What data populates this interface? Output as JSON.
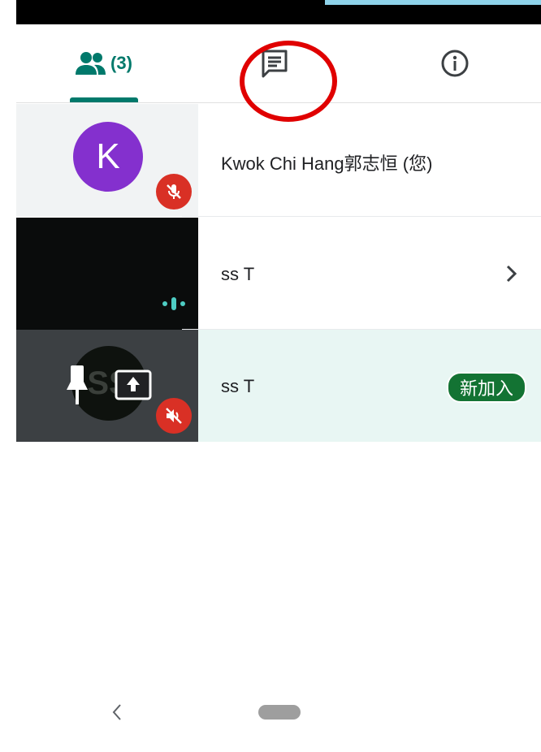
{
  "tabs": {
    "people_count": "(3)",
    "people_icon": "people-icon",
    "chat_icon": "chat-icon",
    "info_icon": "info-icon"
  },
  "colors": {
    "accent": "#00796b",
    "avatar_purple": "#8430ce",
    "mute_red": "#d93025",
    "new_badge": "#137333",
    "highlight_row": "#e8f6f3",
    "annotation_circle": "#e00000"
  },
  "participants": [
    {
      "avatar_letter": "K",
      "name": "Kwok Chi Hang郭志恒 (您)",
      "status_icon": "mic-off-icon"
    },
    {
      "name": "ss T",
      "status_icon": "speaking-indicator-icon",
      "action_icon": "chevron-right-icon"
    },
    {
      "avatar_letter": "SS",
      "name": "ss T",
      "badge": "新加入",
      "status_icon": "volume-off-icon",
      "tile_icons": [
        "pin-icon",
        "present-screen-icon"
      ]
    }
  ],
  "nav": {
    "back_icon": "back-icon",
    "home_icon": "home-pill-icon"
  }
}
